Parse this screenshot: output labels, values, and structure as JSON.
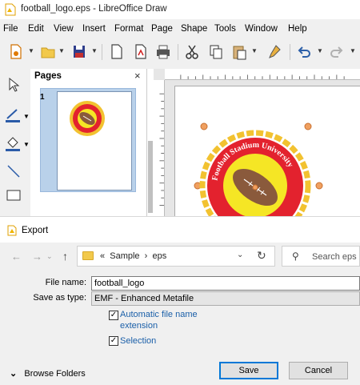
{
  "window": {
    "title": "football_logo.eps - LibreOffice Draw"
  },
  "menubar": {
    "items": [
      "File",
      "Edit",
      "View",
      "Insert",
      "Format",
      "Page",
      "Shape",
      "Tools",
      "Window",
      "Help"
    ]
  },
  "pages_panel": {
    "title": "Pages",
    "close": "×",
    "page_number": "1"
  },
  "logo": {
    "text": "Football Stadium University",
    "colors": {
      "ring": "#e3222e",
      "inner": "#f5e625",
      "ball": "#8a5a3c",
      "chain": "#f2c230"
    }
  },
  "dialog": {
    "title": "Export",
    "path": {
      "prefix": "«",
      "segments": [
        "Sample",
        "eps"
      ],
      "separator": "›"
    },
    "search_placeholder": "Search eps",
    "file_name_label": "File name:",
    "file_name_value": "football_logo",
    "save_as_type_label": "Save as type:",
    "save_as_type_value": "EMF - Enhanced Metafile",
    "auto_extension_label": "Automatic file name extension",
    "auto_extension_checked": true,
    "selection_label": "Selection",
    "selection_checked": true,
    "browse_folders": "Browse Folders",
    "save_button": "Save",
    "cancel_button": "Cancel"
  },
  "icons": {
    "back": "←",
    "forward": "→",
    "up": "↑",
    "dropdown": "⌄",
    "refresh": "↻",
    "search": "⚲",
    "browse_toggle": "⌄",
    "checkmark": "✓"
  },
  "accent_color": "#0078d7"
}
